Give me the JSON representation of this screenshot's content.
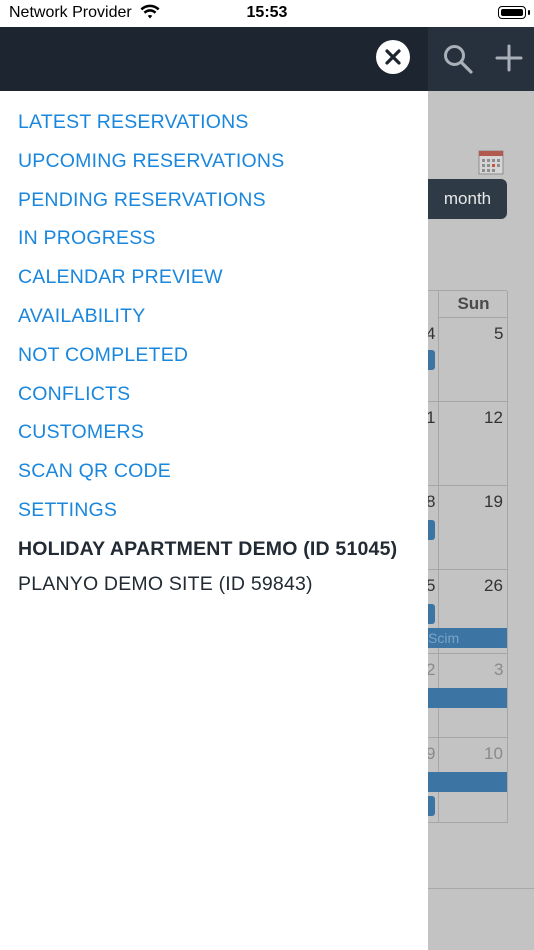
{
  "status_bar": {
    "carrier": "Network Provider",
    "time": "15:53"
  },
  "header": {
    "icons": [
      "close-icon",
      "search-icon",
      "plus-icon"
    ]
  },
  "menu": {
    "items": [
      {
        "label": "LATEST RESERVATIONS"
      },
      {
        "label": "UPCOMING RESERVATIONS"
      },
      {
        "label": "PENDING RESERVATIONS"
      },
      {
        "label": "IN PROGRESS"
      },
      {
        "label": "CALENDAR PREVIEW"
      },
      {
        "label": "AVAILABILITY"
      },
      {
        "label": "NOT COMPLETED"
      },
      {
        "label": "CONFLICTS"
      },
      {
        "label": "CUSTOMERS"
      },
      {
        "label": "SCAN QR CODE"
      },
      {
        "label": "SETTINGS"
      }
    ],
    "sites": [
      {
        "label": "HOLIDAY APARTMENT DEMO (ID 51045)",
        "active": true
      },
      {
        "label": "PLANYO DEMO SITE (ID 59843)",
        "active": false
      }
    ]
  },
  "background": {
    "view_button": "month",
    "calendar": {
      "day_header": "Sun",
      "rows": [
        {
          "prev": "4",
          "sun": "5"
        },
        {
          "prev": "1",
          "sun": "12"
        },
        {
          "prev": "8",
          "sun": "19"
        },
        {
          "prev": "5",
          "sun": "26",
          "event": "Scim"
        },
        {
          "prev": "2",
          "sun": "3"
        },
        {
          "prev": "9",
          "sun": "10"
        }
      ]
    }
  },
  "colors": {
    "header_bg": "#1c2530",
    "link": "#1a87dd",
    "event": "#3c74a4"
  }
}
